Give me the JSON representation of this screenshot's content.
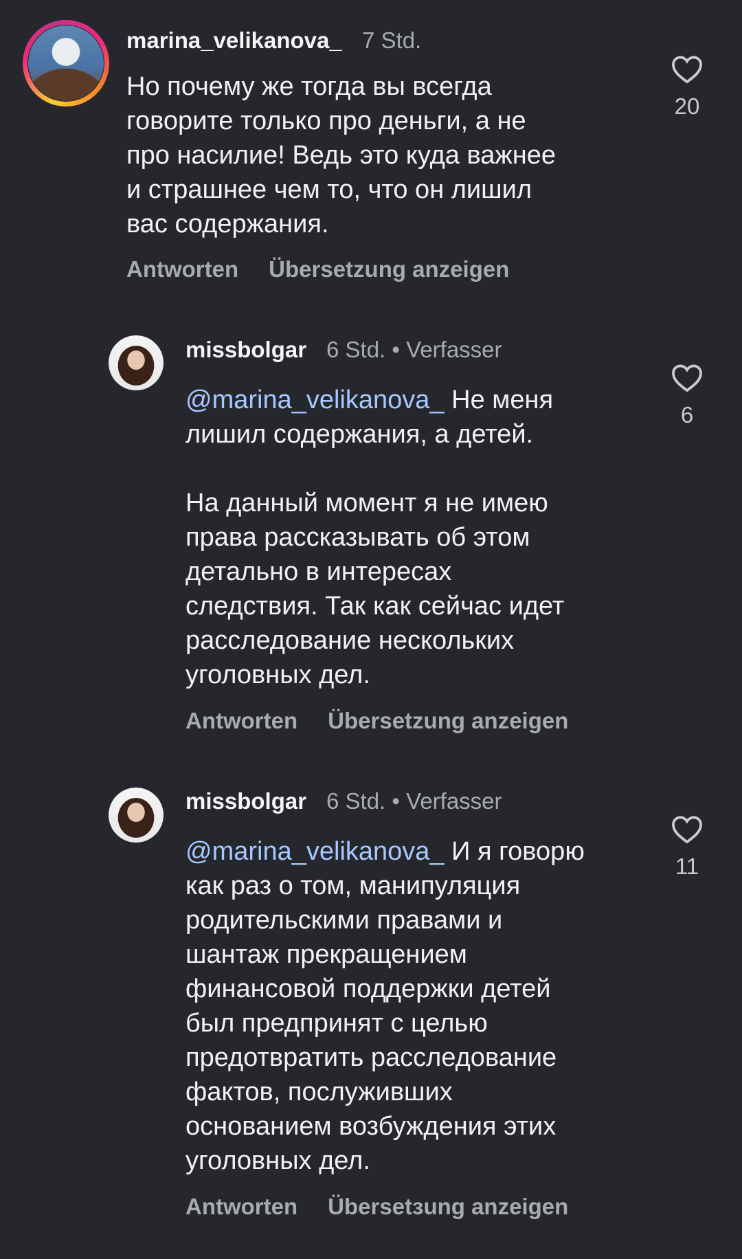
{
  "comments": [
    {
      "username": "marina_velikanova_",
      "time": "7 Std.",
      "badge": "",
      "mention": "",
      "text": "Но почему же тогда вы всегда\nговорите только про деньги, а не\nпро насилие! Ведь это куда важнее\nи страшнее чем то, что он лишил\nвас содержания.",
      "reply_label": "Antworten",
      "translate_label": "Übersetzung anzeigen",
      "likes": "20"
    },
    {
      "username": "missbolgar",
      "time": "6 Std.",
      "badge": "Verfasser",
      "mention": "@marina_velikanova_",
      "text": " Не меня\nлишил содержания, а детей.\n\nНа данный момент я не имею\nправа рассказывать об этом\nдетально в интересах\nследствия. Так как сейчас идет\nрасследование нескольких\nуголовных дел.",
      "reply_label": "Antworten",
      "translate_label": "Übersetzung anzeigen",
      "likes": "6"
    },
    {
      "username": "missbolgar",
      "time": "6 Std.",
      "badge": "Verfasser",
      "mention": "@marina_velikanova_",
      "text": " И я говорю\nкак раз о том, манипуляция\nродительскими правами и\nшантаж прекращением\nфинансовой поддержки детей\nбыл предпринят с целью\nпредотвратить расследование\nфактов, послуживших\nоснованием возбуждения этих\nуголовных дел.",
      "reply_label": "Antworten",
      "translate_label": "Übersetзung anzeigen",
      "likes": "11"
    }
  ],
  "icons": {
    "like": "heart-outline-icon"
  },
  "colors": {
    "background": "#25272c",
    "mention": "#a6c8ff",
    "secondary_text": "#a8abb1"
  }
}
